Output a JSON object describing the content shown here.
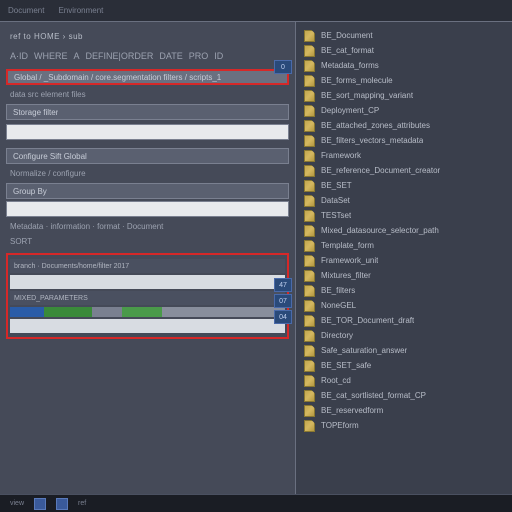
{
  "titlebar": {
    "menu1": "Document",
    "menu2": "Environment"
  },
  "breadcrumb": "ref  to  HOME  ›  sub",
  "toolbar": [
    "A·ID",
    "WHERE",
    "A",
    "DEFINE|ORDER",
    "DATE",
    "PRO",
    "ID"
  ],
  "fields": {
    "f1": "Global / _Subdomain / core.segmentation filters / scripts_1",
    "f2": "Storage filter",
    "f3": "Configure  Sift Global",
    "f4": "Normalize / configure",
    "f5": "Group By",
    "f6": "Metadata · information · format · Document"
  },
  "labels": {
    "l1": "data  src element files",
    "l2": "SORT"
  },
  "redbox": {
    "r1": "branch · Documents/home/filter 2017",
    "r2": "MIXED_PARAMETERS"
  },
  "badges": [
    "0",
    "47",
    "07",
    "04"
  ],
  "files": [
    "BE_Document",
    "BE_cat_format",
    "Metadata_forms",
    "BE_forms_molecule",
    "BE_sort_mapping_variant",
    "Deployment_CP",
    "BE_attached_zones_attributes",
    "BE_filters_vectors_metadata",
    "Framework",
    "BE_reference_Document_creator",
    "BE_SET",
    "DataSet",
    "TESTset",
    "Mixed_datasource_selector_path",
    "Template_form",
    "Framework_unit",
    "Mixtures_filter",
    "BE_filters",
    "NoneGEL",
    "BE_TOR_Document_draft",
    "Directory",
    "Safe_saturation_answer",
    "BE_SET_safe",
    "Root_cd",
    "BE_cat_sortlisted_format_CP",
    "BE_reservedform",
    "TOPEform"
  ],
  "status": {
    "s1": "view",
    "s2": "ref"
  }
}
